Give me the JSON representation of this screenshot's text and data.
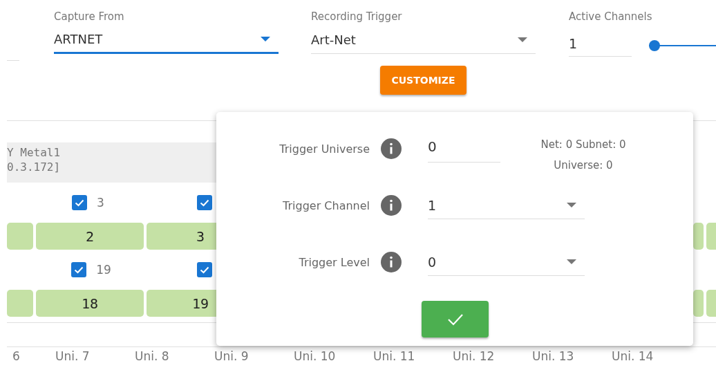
{
  "capture_from": {
    "label": "Capture From",
    "value": "ARTNET",
    "focused": true
  },
  "recording_trigger": {
    "label": "Recording Trigger",
    "value": "Art-Net"
  },
  "active_channels": {
    "label": "Active Channels",
    "value": "1",
    "level": 0
  },
  "customize_button": "CUSTOMIZE",
  "device": {
    "name": "Y Metal1",
    "address": "0.3.172]"
  },
  "channel_rows": [
    {
      "checkboxes": [
        {
          "label": "3",
          "checked": true
        },
        {
          "checked": true
        }
      ],
      "cells": [
        "2",
        "3"
      ]
    },
    {
      "checkboxes": [
        {
          "label": "19",
          "checked": true
        },
        {
          "checked": true
        }
      ],
      "cells": [
        "18",
        "19"
      ]
    }
  ],
  "universe_tabs": [
    "6",
    "Uni. 7",
    "Uni. 8",
    "Uni. 9",
    "Uni. 10",
    "Uni. 11",
    "Uni. 12",
    "Uni. 13",
    "Uni. 14"
  ],
  "trigger_dialog": {
    "fields": [
      {
        "kind": "text",
        "label": "Trigger Universe",
        "value": "0",
        "note": [
          "Net: 0 Subnet: 0",
          "Universe: 0"
        ]
      },
      {
        "kind": "select",
        "label": "Trigger Channel",
        "value": "1"
      },
      {
        "kind": "select",
        "label": "Trigger Level",
        "value": "0"
      }
    ]
  }
}
